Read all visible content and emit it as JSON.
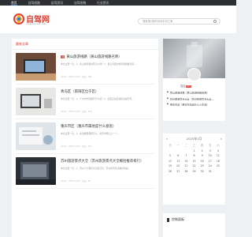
{
  "topnav": {
    "items": [
      "首页",
      "自驾线路",
      "自驾资讯",
      "自驾攻略",
      "行业资讯"
    ]
  },
  "header": {
    "logo_text": "自驾网",
    "logo_sub": "zijia.uucms.net",
    "search_placeholder": "搜索第1篇的自动手机之家"
  },
  "main": {
    "section_title": "最新文章",
    "posts": [
      {
        "title": "黄山旅游线路（黄山旅游线路名称）",
        "excerpt": "本文主要一览：1、黄山旅游路线该怎么样？2、黄山景区的旅游线路推荐吗…",
        "meta": "admin · 2023-10-05 · 阅读：189"
      },
      {
        "title": "青岛区（南阳区位于区）",
        "excerpt": "本文主要一览：1、广州市市区都有什么区？2、此区正在加油这边是否有…",
        "meta": "admin · 2023-10-05 · 阅读：116"
      },
      {
        "title": "重庆市区（重庆市属地是什么意思）",
        "excerpt": "本文主要一览：1、在渝哪里都很可以，重庆市哪儿上一个…",
        "meta": "admin · 2023-10-05 · 阅读：101"
      },
      {
        "title": "苏州旅游景点大全（苏州旅游景点大全概括推荐排行）",
        "excerpt": "本文主要一览：1、苏州十大著名景点自己们，苏州旅游景点推荐的美…",
        "meta": "admin · 2023-10-05 · 阅读：96"
      }
    ]
  },
  "sidebar": {
    "profile_name": "佳佳",
    "profile_level": "LV1",
    "hot_list": [
      "黄山旅游线路（黄山旅游线路名称）",
      "苏州旅游景点大全（苏州旅游景点大全…",
      "重庆东站（重庆东站是什么火车站）"
    ],
    "calendar": {
      "prev": "«",
      "title": "2025年1月",
      "next": "»",
      "weekdays": [
        "日",
        "一",
        "二",
        "三",
        "四",
        "五",
        "六"
      ],
      "cells": [
        "",
        "",
        "",
        "1",
        "2",
        "3",
        "4",
        "5",
        "6",
        "7",
        "8",
        "9",
        "10",
        "11",
        "12",
        "13",
        "14",
        "15",
        "16",
        "17",
        "18",
        "19",
        "20",
        "21",
        "22",
        "23",
        "24",
        "25",
        "26",
        "27",
        "28",
        "29",
        "30",
        "31",
        ""
      ]
    },
    "ctrl_title": "控制面板"
  },
  "colors": {
    "accent": "#e33b2d",
    "topbar": "#2d2f33",
    "page_bg": "#eef1f4"
  }
}
